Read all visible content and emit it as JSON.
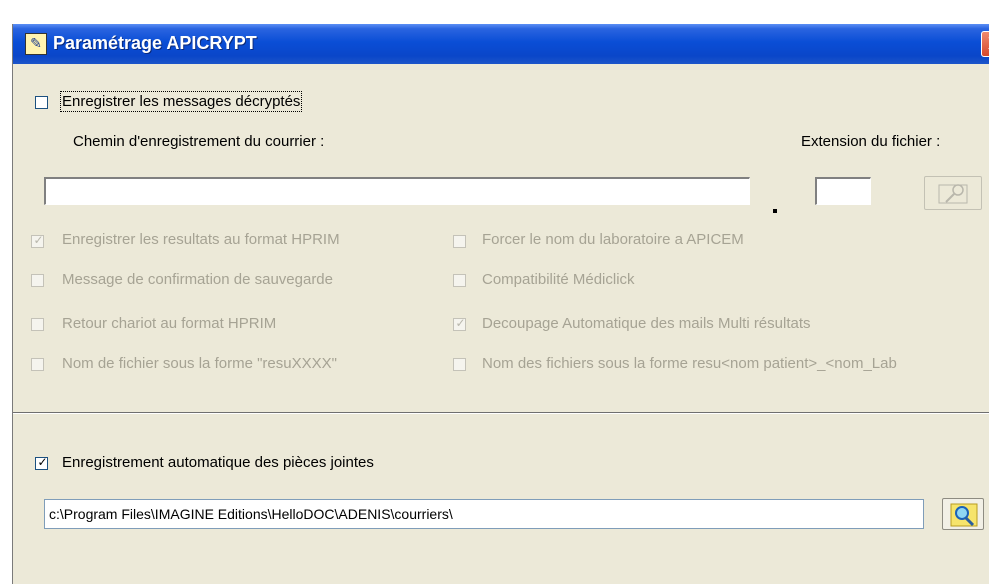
{
  "window": {
    "title": "Paramétrage APICRYPT",
    "icon": "apicrypt-app-icon",
    "close_glyph": "X"
  },
  "decrypt": {
    "save_label": "Enregistrer les messages décryptés",
    "save_checked": false,
    "path_label": "Chemin d'enregistrement du courrier :",
    "extension_label": "Extension du fichier :",
    "path_value": "",
    "extension_value": "",
    "dot_separator": "."
  },
  "options_left": [
    {
      "label": "Enregistrer les resultats au format HPRIM",
      "checked": true
    },
    {
      "label": "Message de confirmation de sauvegarde",
      "checked": false
    },
    {
      "label": "Retour chariot au format HPRIM",
      "checked": false
    },
    {
      "label": "Nom de fichier sous la forme \"resuXXXX\"",
      "checked": false
    }
  ],
  "options_right": [
    {
      "label": "Forcer le nom du laboratoire a APICEM",
      "checked": false
    },
    {
      "label": "Compatibilité Médiclick",
      "checked": false
    },
    {
      "label": "Decoupage Automatique des mails Multi résultats",
      "checked": true
    },
    {
      "label": "Nom des fichiers sous la forme resu<nom patient>_<nom_Lab",
      "checked": false
    }
  ],
  "attachments": {
    "label": "Enregistrement automatique des pièces jointes",
    "checked": true,
    "path_value": "c:\\Program Files\\IMAGINE Editions\\HelloDOC\\ADENIS\\courriers\\"
  },
  "icons": {
    "browse_disabled": "folder-search-icon",
    "browse_enabled": "magnifier-icon"
  },
  "colors": {
    "titlebar": "#0a4ed6",
    "dialog_bg": "#ece9d8",
    "disabled_text": "#a6a394",
    "checkmark": "#21a121"
  }
}
